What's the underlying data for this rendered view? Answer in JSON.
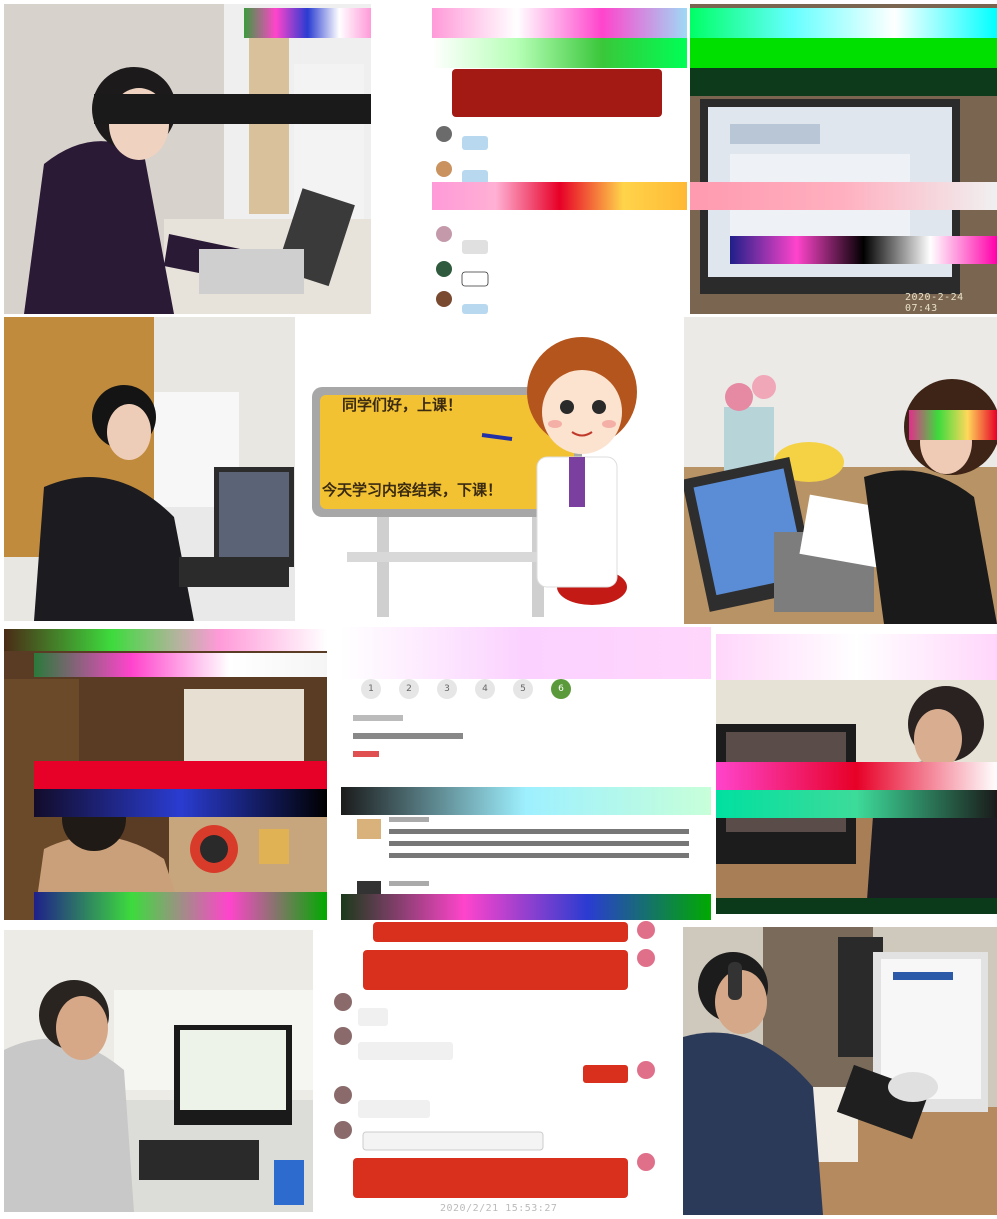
{
  "collage": {
    "board": {
      "greeting": "同学们好，上课！",
      "closing": "今天学习内容结束，下课！"
    },
    "photos": {
      "timestamp": "2020-2-24 07:43",
      "bottom_timestamp": "2020/2/21 15:53:27"
    },
    "quiz": {
      "pages": [
        "1",
        "2",
        "3",
        "4",
        "5",
        "6"
      ],
      "current_page": "6"
    },
    "colors": {
      "chat_bubble_red": "#d9301e",
      "board_yellow": "#f2c233",
      "page_active": "#5a9a3a"
    }
  }
}
